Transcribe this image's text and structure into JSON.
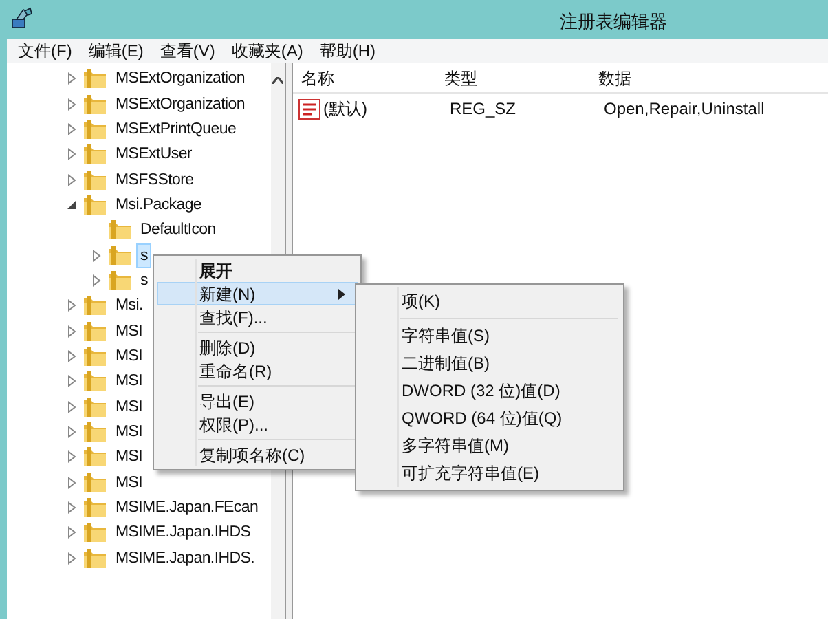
{
  "window": {
    "title": "注册表编辑器"
  },
  "menu_bar": [
    {
      "label": "文件(F)"
    },
    {
      "label": "编辑(E)"
    },
    {
      "label": "查看(V)"
    },
    {
      "label": "收藏夹(A)"
    },
    {
      "label": "帮助(H)"
    }
  ],
  "tree": [
    {
      "label": "MSExtOrganization",
      "kind": "branch",
      "expanded": false,
      "selected": false
    },
    {
      "label": "MSExtOrganization",
      "kind": "branch",
      "expanded": false,
      "selected": false
    },
    {
      "label": "MSExtPrintQueue",
      "kind": "branch",
      "expanded": false,
      "selected": false
    },
    {
      "label": "MSExtUser",
      "kind": "branch",
      "expanded": false,
      "selected": false
    },
    {
      "label": "MSFSStore",
      "kind": "branch",
      "expanded": false,
      "selected": false
    },
    {
      "label": "Msi.Package",
      "kind": "branch",
      "expanded": true,
      "selected": false,
      "children": [
        {
          "label": "DefaultIcon",
          "kind": "leaf",
          "selected": false
        },
        {
          "label": "s",
          "kind": "branch",
          "expanded": false,
          "selected": true
        },
        {
          "label": "s",
          "kind": "branch",
          "expanded": false,
          "selected": false
        }
      ]
    },
    {
      "label": "Msi.",
      "kind": "branch",
      "expanded": false,
      "selected": false
    },
    {
      "label": "MSI",
      "kind": "branch",
      "expanded": false,
      "selected": false
    },
    {
      "label": "MSI",
      "kind": "branch",
      "expanded": false,
      "selected": false
    },
    {
      "label": "MSI",
      "kind": "branch",
      "expanded": false,
      "selected": false
    },
    {
      "label": "MSI",
      "kind": "branch",
      "expanded": false,
      "selected": false
    },
    {
      "label": "MSI",
      "kind": "branch",
      "expanded": false,
      "selected": false
    },
    {
      "label": "MSI",
      "kind": "branch",
      "expanded": false,
      "selected": false
    },
    {
      "label": "MSI",
      "kind": "branch",
      "expanded": false,
      "selected": false
    },
    {
      "label": "MSIME.Japan.FEcan",
      "kind": "branch",
      "expanded": false,
      "selected": false
    },
    {
      "label": "MSIME.Japan.IHDS",
      "kind": "branch",
      "expanded": false,
      "selected": false
    },
    {
      "label": "MSIME.Japan.IHDS.",
      "kind": "branch",
      "expanded": false,
      "selected": false
    }
  ],
  "values_list": {
    "columns": [
      "名称",
      "类型",
      "数据"
    ],
    "rows": [
      {
        "name": "(默认)",
        "type": "REG_SZ",
        "data": "Open,Repair,Uninstall"
      }
    ]
  },
  "context_menu": {
    "groups": [
      [
        {
          "label": "展开",
          "default": true,
          "selected": false,
          "has_submenu": false
        },
        {
          "label": "新建(N)",
          "default": false,
          "selected": true,
          "has_submenu": true
        },
        {
          "label": "查找(F)...",
          "default": false,
          "selected": false,
          "has_submenu": false
        }
      ],
      [
        {
          "label": "删除(D)",
          "default": false,
          "selected": false,
          "has_submenu": false
        },
        {
          "label": "重命名(R)",
          "default": false,
          "selected": false,
          "has_submenu": false
        }
      ],
      [
        {
          "label": "导出(E)",
          "default": false,
          "selected": false,
          "has_submenu": false
        },
        {
          "label": "权限(P)...",
          "default": false,
          "selected": false,
          "has_submenu": false
        }
      ],
      [
        {
          "label": "复制项名称(C)",
          "default": false,
          "selected": false,
          "has_submenu": false
        }
      ]
    ]
  },
  "submenu": {
    "groups": [
      [
        {
          "label": "项(K)"
        }
      ],
      [
        {
          "label": "字符串值(S)"
        },
        {
          "label": "二进制值(B)"
        },
        {
          "label": "DWORD (32 位)值(D)"
        },
        {
          "label": "QWORD (64 位)值(Q)"
        },
        {
          "label": "多字符串值(M)"
        },
        {
          "label": "可扩充字符串值(E)"
        }
      ]
    ]
  }
}
